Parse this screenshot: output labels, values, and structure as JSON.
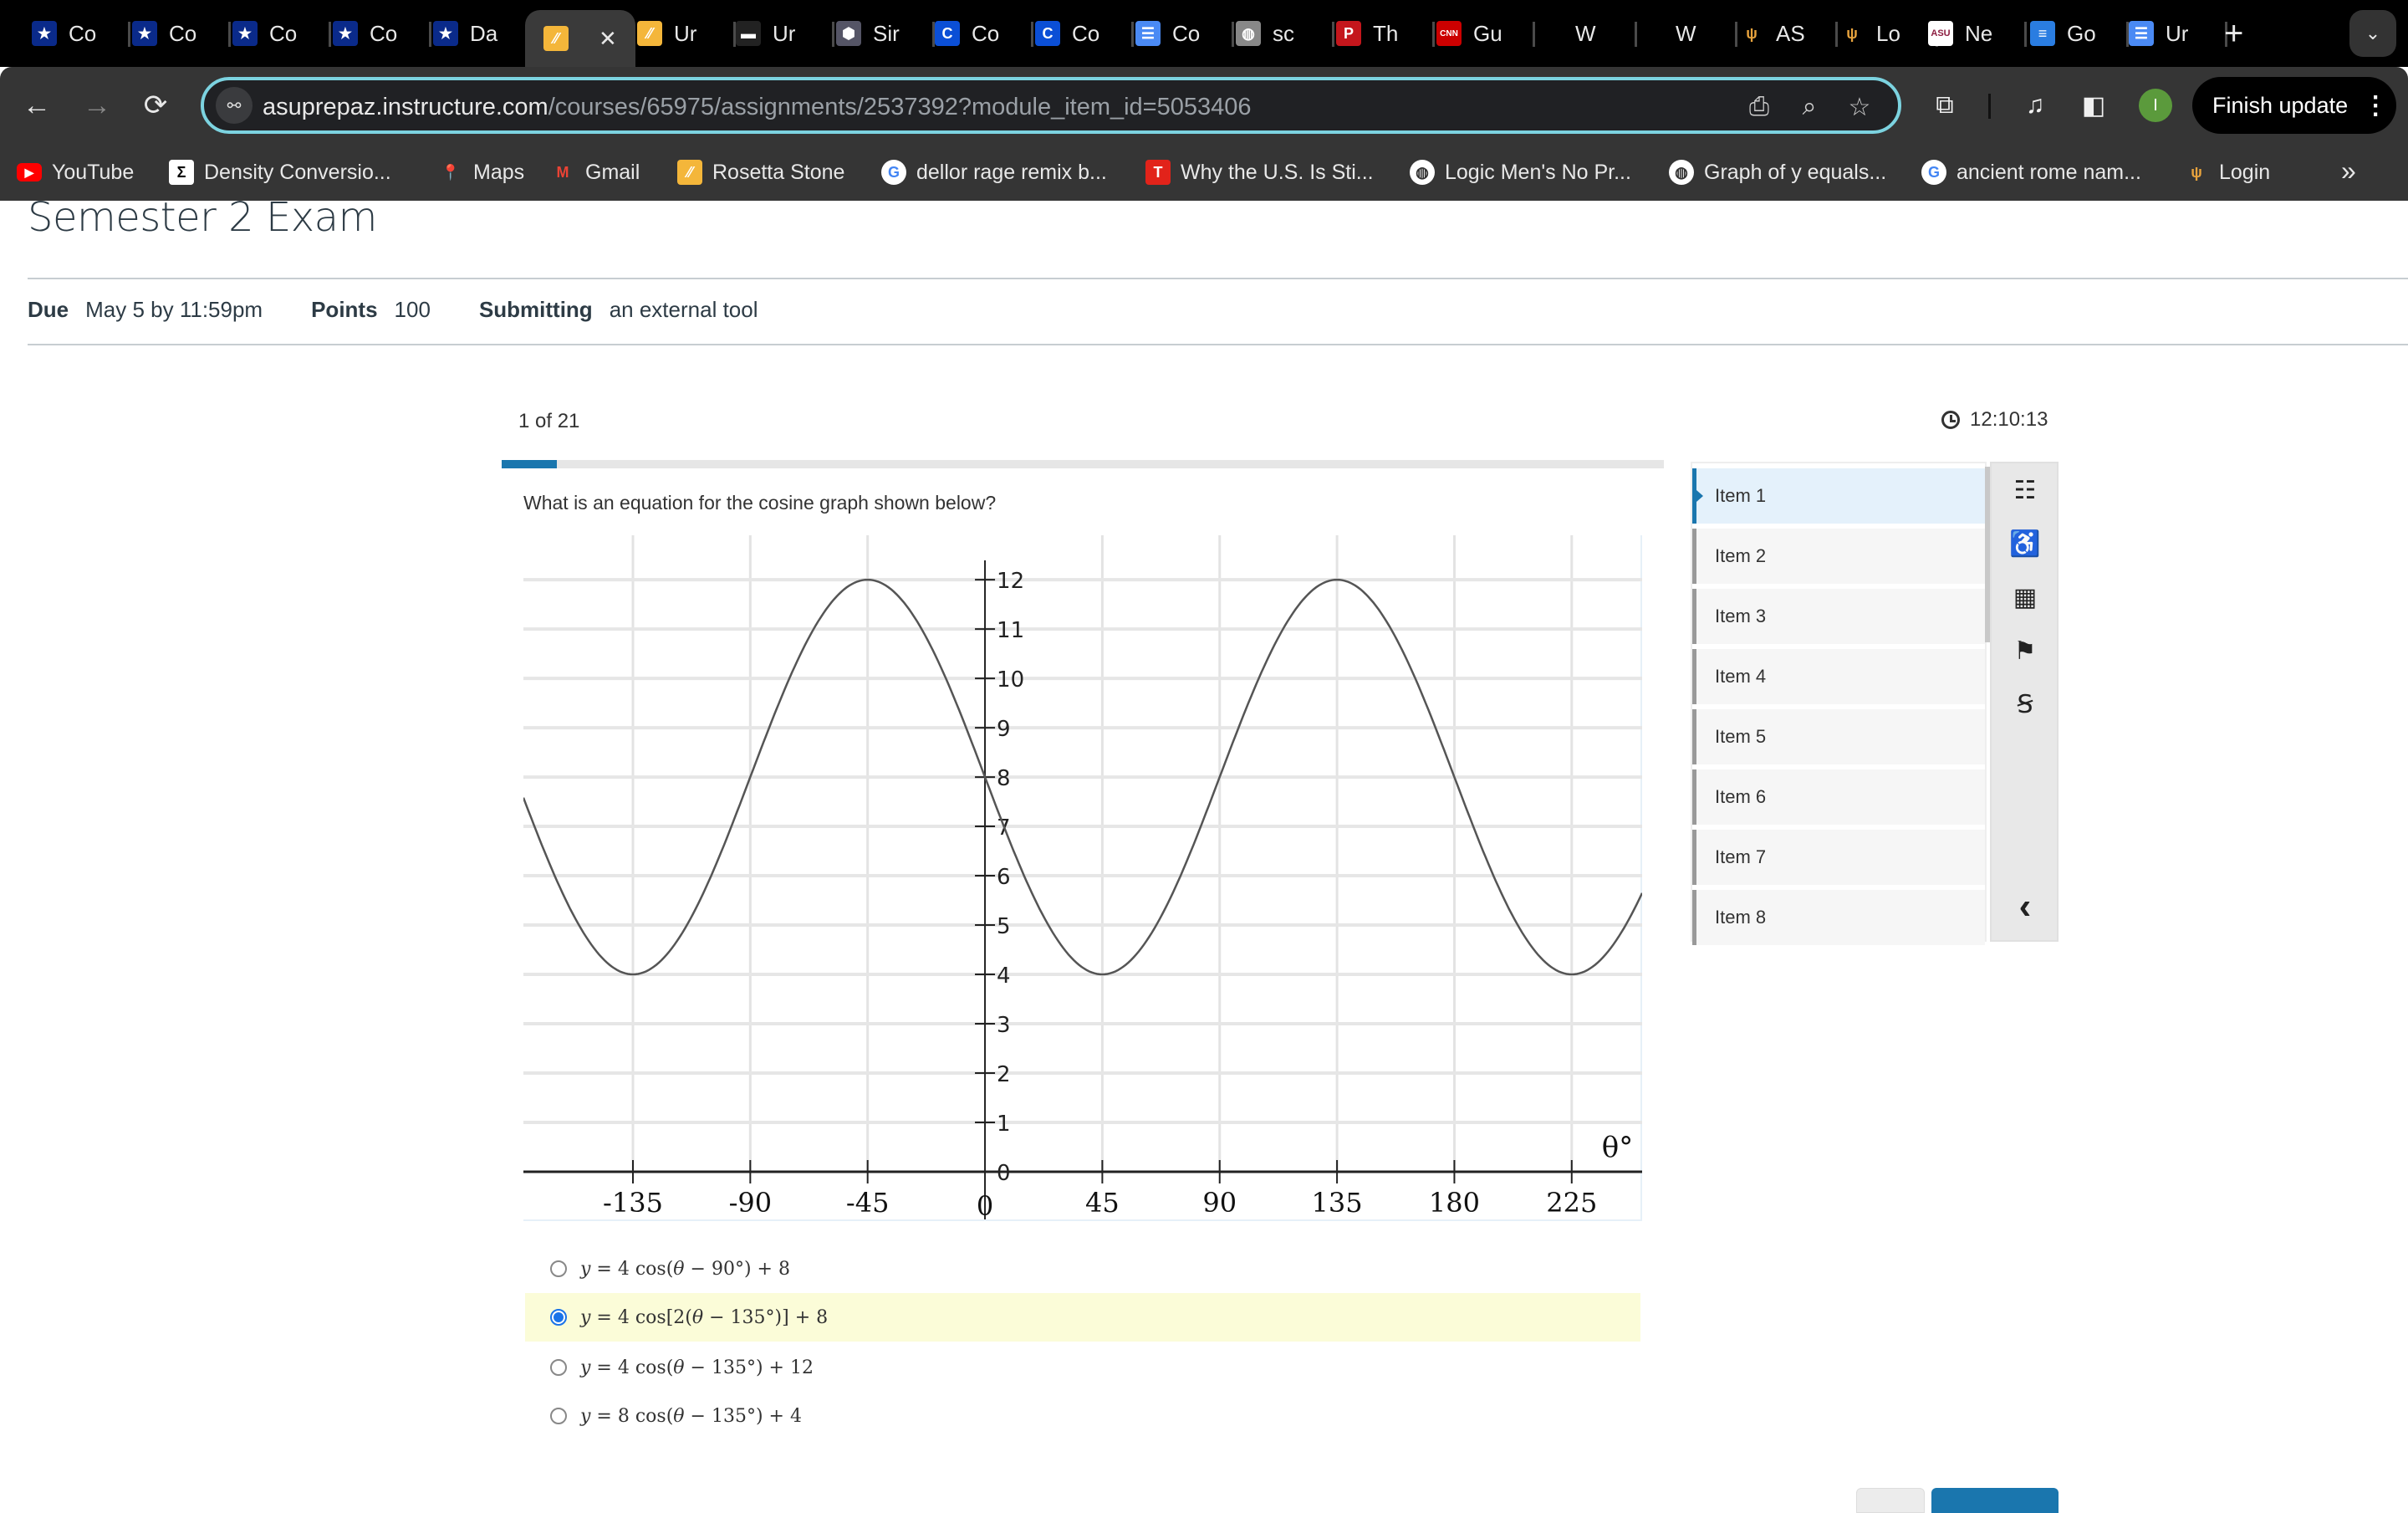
{
  "browser": {
    "tabs": [
      {
        "title": "Co",
        "icon": "star-shield-icon",
        "icon_bg": "#0a2a8a",
        "active": false
      },
      {
        "title": "Co",
        "icon": "star-shield-icon",
        "icon_bg": "#0a2a8a",
        "active": false
      },
      {
        "title": "Co",
        "icon": "star-shield-icon",
        "icon_bg": "#0a2a8a",
        "active": false
      },
      {
        "title": "Co",
        "icon": "star-shield-icon",
        "icon_bg": "#0a2a8a",
        "active": false
      },
      {
        "title": "Da",
        "icon": "star-shield-icon",
        "icon_bg": "#0a2a8a",
        "active": false
      },
      {
        "title": "",
        "icon": "rosetta-icon",
        "icon_bg": "#f4b63a",
        "active": true,
        "close": "✕"
      },
      {
        "title": "Ur",
        "icon": "rosetta-icon",
        "icon_bg": "#f4b63a",
        "active": false
      },
      {
        "title": "Ur",
        "icon": "color-bar-icon",
        "icon_bg": "#222",
        "active": false
      },
      {
        "title": "Sir",
        "icon": "hexagon-cluster-icon",
        "icon_bg": "#556",
        "active": false
      },
      {
        "title": "Co",
        "icon": "c-circle-icon",
        "icon_bg": "#0b4fd6",
        "active": false
      },
      {
        "title": "Co",
        "icon": "c-circle-icon",
        "icon_bg": "#0b4fd6",
        "active": false
      },
      {
        "title": "Co",
        "icon": "docs-lines-icon",
        "icon_bg": "#4a8af4",
        "active": false
      },
      {
        "title": "sc",
        "icon": "globe-icon",
        "icon_bg": "#888",
        "active": false
      },
      {
        "title": "Th",
        "icon": "p-letter-icon",
        "icon_bg": "#c4161c",
        "active": false
      },
      {
        "title": "Gu",
        "icon": "cnn-icon",
        "icon_bg": "#cc0000",
        "active": false
      },
      {
        "title": "W",
        "icon": "",
        "icon_bg": "transparent",
        "active": false
      },
      {
        "title": "W",
        "icon": "",
        "icon_bg": "transparent",
        "active": false
      },
      {
        "title": "AS",
        "icon": "pitchfork-icon",
        "icon_bg": "transparent",
        "active": false
      },
      {
        "title": "Lo",
        "icon": "pitchfork-icon",
        "icon_bg": "transparent",
        "active": false
      },
      {
        "title": "Ne",
        "icon": "asu-logo-icon",
        "icon_bg": "#ffffff",
        "active": false
      },
      {
        "title": "Go",
        "icon": "google-docs-icon",
        "icon_bg": "#2a7de1",
        "active": false
      },
      {
        "title": "Ur",
        "icon": "docs-lines-icon",
        "icon_bg": "#4a8af4",
        "active": false
      }
    ],
    "new_tab": "+",
    "tab_list": "⌄",
    "url_host": "asuprepaz.instructure.com",
    "url_path": "/courses/65975/assignments/2537392?module_item_id=5053406",
    "finish_update": "Finish update",
    "profile_initial": "I",
    "bookmarks": [
      {
        "label": "YouTube",
        "icon": "youtube-icon",
        "icon_bg": "#ff0000",
        "glyph": "▶"
      },
      {
        "label": "Density Conversio...",
        "icon": "sigma-icon",
        "icon_bg": "#ffffff",
        "glyph": "Σ"
      },
      {
        "label": "Maps",
        "icon": "maps-pin-icon",
        "icon_bg": "transparent",
        "glyph": "📍"
      },
      {
        "label": "Gmail",
        "icon": "gmail-icon",
        "icon_bg": "transparent",
        "glyph": "M"
      },
      {
        "label": "Rosetta Stone",
        "icon": "rosetta-icon",
        "icon_bg": "#f4b63a",
        "glyph": "⁄⁄"
      },
      {
        "label": "dellor rage remix b...",
        "icon": "google-icon",
        "icon_bg": "#ffffff",
        "glyph": "G"
      },
      {
        "label": "Why the U.S. Is Sti...",
        "icon": "t-letter-icon",
        "icon_bg": "#e2231a",
        "glyph": "T"
      },
      {
        "label": "Logic Men's No Pr...",
        "icon": "globe-icon",
        "icon_bg": "#ffffff",
        "glyph": "◍"
      },
      {
        "label": "Graph of y equals...",
        "icon": "globe-icon",
        "icon_bg": "#ffffff",
        "glyph": "◍"
      },
      {
        "label": "ancient rome nam...",
        "icon": "google-icon",
        "icon_bg": "#ffffff",
        "glyph": "G"
      },
      {
        "label": "Login",
        "icon": "pitchfork-icon",
        "icon_bg": "transparent",
        "glyph": "ψ"
      }
    ],
    "bookmarks_more": "»"
  },
  "assignment": {
    "title": "Semester 2 Exam",
    "due_label": "Due",
    "due_value": "May 5 by 11:59pm",
    "points_label": "Points",
    "points_value": "100",
    "submitting_label": "Submitting",
    "submitting_value": "an external tool"
  },
  "quiz": {
    "counter": "1 of 21",
    "current_item": 1,
    "total_items": 21,
    "progress_fraction": 0.0476,
    "timer": "12:10:13",
    "question": "What is an equation for the cosine graph shown below?",
    "choices": [
      {
        "text_parts": [
          "y",
          " = 4 cos(",
          "θ",
          " − 90°) + 8"
        ],
        "selected": false
      },
      {
        "text_parts": [
          "y",
          " = 4 cos[2(",
          "θ",
          " − 135°)] + 8"
        ],
        "selected": true
      },
      {
        "text_parts": [
          "y",
          " = 4 cos(",
          "θ",
          " − 135°) + 12"
        ],
        "selected": false
      },
      {
        "text_parts": [
          "y",
          " = 8 cos(",
          "θ",
          " − 135°) + 4"
        ],
        "selected": false
      }
    ],
    "nav_items": [
      "Item 1",
      "Item 2",
      "Item 3",
      "Item 4",
      "Item 5",
      "Item 6",
      "Item 7",
      "Item 8"
    ],
    "active_nav_index": 0,
    "tools": [
      {
        "name": "item-list-icon",
        "glyph": "☷"
      },
      {
        "name": "accessibility-icon",
        "glyph": "♿"
      },
      {
        "name": "calculator-icon",
        "glyph": "▦"
      },
      {
        "name": "flag-icon",
        "glyph": "⚑"
      },
      {
        "name": "strikethrough-icon",
        "glyph": "Ꞩ"
      },
      {
        "name": "collapse-chevron-icon",
        "glyph": "‹"
      }
    ]
  },
  "chart_data": {
    "type": "line",
    "title": "",
    "xlabel": "θ°",
    "ylabel": "",
    "x_ticks": [
      -135,
      -90,
      -45,
      0,
      45,
      90,
      135,
      180,
      225
    ],
    "y_ticks": [
      0,
      1,
      2,
      3,
      4,
      5,
      6,
      7,
      8,
      9,
      10,
      11,
      12
    ],
    "xlim": [
      -177,
      252
    ],
    "ylim": [
      -1,
      12.9
    ],
    "grid": true,
    "series": [
      {
        "name": "cosine curve",
        "amplitude": 4,
        "midline": 8,
        "period_deg": 180,
        "phase_shift_deg": 135,
        "key_points": [
          {
            "x": -135,
            "y": 4
          },
          {
            "x": -90,
            "y": 8
          },
          {
            "x": -45,
            "y": 12
          },
          {
            "x": 0,
            "y": 8
          },
          {
            "x": 45,
            "y": 4
          },
          {
            "x": 90,
            "y": 8
          },
          {
            "x": 135,
            "y": 12
          },
          {
            "x": 180,
            "y": 8
          },
          {
            "x": 225,
            "y": 4
          }
        ]
      }
    ]
  }
}
